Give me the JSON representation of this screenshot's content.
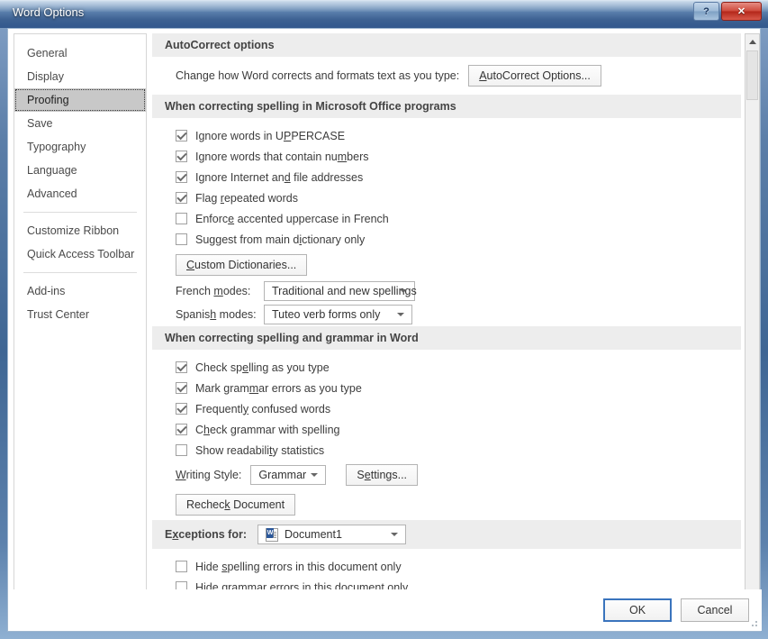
{
  "window": {
    "title": "Word Options",
    "help_button": "?",
    "close_button": "✕"
  },
  "sidebar": {
    "groups": [
      {
        "items": [
          {
            "label": "General",
            "selected": false
          },
          {
            "label": "Display",
            "selected": false
          },
          {
            "label": "Proofing",
            "selected": true
          },
          {
            "label": "Save",
            "selected": false
          },
          {
            "label": "Typography",
            "selected": false
          },
          {
            "label": "Language",
            "selected": false
          },
          {
            "label": "Advanced",
            "selected": false
          }
        ]
      },
      {
        "items": [
          {
            "label": "Customize Ribbon",
            "selected": false
          },
          {
            "label": "Quick Access Toolbar",
            "selected": false
          }
        ]
      },
      {
        "items": [
          {
            "label": "Add-ins",
            "selected": false
          },
          {
            "label": "Trust Center",
            "selected": false
          }
        ]
      }
    ]
  },
  "content": {
    "autocorrect": {
      "heading": "AutoCorrect options",
      "description": "Change how Word corrects and formats text as you type:",
      "button": "AutoCorrect Options..."
    },
    "office_spelling": {
      "heading": "When correcting spelling in Microsoft Office programs",
      "checkboxes": [
        {
          "label": "Ignore words in UPPERCASE",
          "checked": true
        },
        {
          "label": "Ignore words that contain numbers",
          "checked": true
        },
        {
          "label": "Ignore Internet and file addresses",
          "checked": true
        },
        {
          "label": "Flag repeated words",
          "checked": true
        },
        {
          "label": "Enforce accented uppercase in French",
          "checked": false
        },
        {
          "label": "Suggest from main dictionary only",
          "checked": false
        }
      ],
      "custom_dictionaries_button": "Custom Dictionaries...",
      "french_modes_label": "French modes:",
      "french_modes_value": "Traditional and new spellings",
      "spanish_modes_label": "Spanish modes:",
      "spanish_modes_value": "Tuteo verb forms only"
    },
    "word_grammar": {
      "heading": "When correcting spelling and grammar in Word",
      "checkboxes": [
        {
          "label": "Check spelling as you type",
          "checked": true
        },
        {
          "label": "Mark grammar errors as you type",
          "checked": true
        },
        {
          "label": "Frequently confused words",
          "checked": true
        },
        {
          "label": "Check grammar with spelling",
          "checked": true
        },
        {
          "label": "Show readability statistics",
          "checked": false
        }
      ],
      "writing_style_label": "Writing Style:",
      "writing_style_value": "Grammar",
      "settings_button": "Settings...",
      "recheck_button": "Recheck Document"
    },
    "exceptions": {
      "heading": "Exceptions for:",
      "document_icon": "word-document-icon",
      "document_value": "Document1",
      "checkboxes": [
        {
          "label": "Hide spelling errors in this document only",
          "checked": false
        },
        {
          "label": "Hide grammar errors in this document only",
          "checked": false
        }
      ]
    }
  },
  "footer": {
    "ok_label": "OK",
    "cancel_label": "Cancel"
  }
}
